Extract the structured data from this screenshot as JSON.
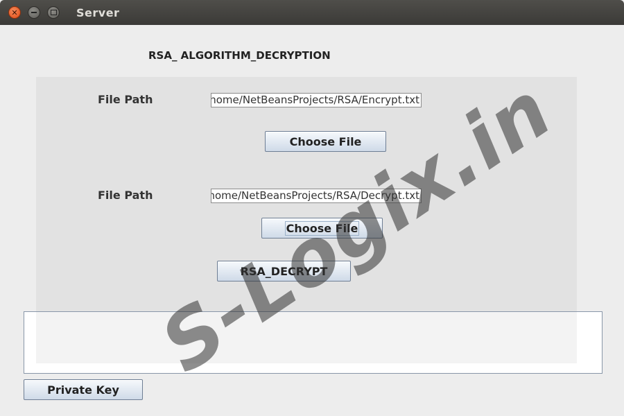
{
  "window": {
    "title": "Server"
  },
  "heading": "RSA_ ALGORITHM_DECRYPTION",
  "encrypt_row": {
    "label": "File Path",
    "value": "/home/NetBeansProjects/RSA/Encrypt.txt",
    "button": "Choose File"
  },
  "decrypt_row": {
    "label": "File Path",
    "value": "/home/NetBeansProjects/RSA/Decrypt.txt",
    "button": "Choose File"
  },
  "decrypt_button": "RSA_DECRYPT",
  "output_text": "",
  "private_key_button": "Private Key",
  "watermark": "S-Logix.in"
}
